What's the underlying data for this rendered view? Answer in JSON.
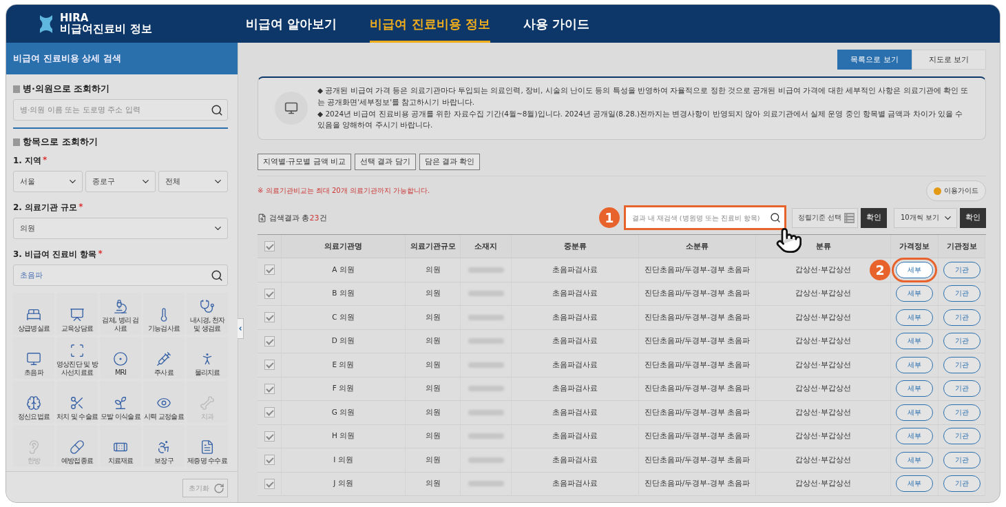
{
  "header": {
    "logo_title": "HIRA",
    "logo_subtitle": "비급여진료비 정보",
    "nav": [
      {
        "label": "비급여 알아보기",
        "selected": false
      },
      {
        "label": "비급여 진료비용 정보",
        "selected": true
      },
      {
        "label": "사용 가이드",
        "selected": false
      }
    ]
  },
  "sidebar": {
    "title": "비급여 진료비용 상세 검색",
    "hospital_search": {
      "heading": "병·의원으로 조회하기",
      "placeholder": "병·의원 이름 또는 도로명 주소 입력"
    },
    "item_search": {
      "heading": "항목으로 조회하기",
      "region": {
        "label": "1. 지역",
        "required": "*",
        "selects": [
          "서울",
          "종로구",
          "전체"
        ]
      },
      "scale": {
        "label": "2. 의료기관 규모",
        "required": "*",
        "value": "의원"
      },
      "item": {
        "label": "3. 비급여 진료비 항목",
        "required": "*",
        "value": "초음파"
      },
      "categories": [
        {
          "label": "상급병실료",
          "disabled": false
        },
        {
          "label": "교육상담료",
          "disabled": false
        },
        {
          "label": "검체, 병리 검사료",
          "disabled": false
        },
        {
          "label": "기능검사료",
          "disabled": false
        },
        {
          "label": "내시경, 천자 및 생검료",
          "disabled": false
        },
        {
          "label": "초음파",
          "disabled": false
        },
        {
          "label": "영상진단 및 방사선치료료",
          "disabled": false
        },
        {
          "label": "MRI",
          "disabled": false
        },
        {
          "label": "주사료",
          "disabled": false
        },
        {
          "label": "물리치료",
          "disabled": false
        },
        {
          "label": "정신요법료",
          "disabled": false
        },
        {
          "label": "처치 및 수술료",
          "disabled": false
        },
        {
          "label": "모발 이식술료",
          "disabled": false
        },
        {
          "label": "시력 교정술료",
          "disabled": false
        },
        {
          "label": "치과",
          "disabled": true
        },
        {
          "label": "한방",
          "disabled": true
        },
        {
          "label": "예방접종료",
          "disabled": false
        },
        {
          "label": "치료재료",
          "disabled": false
        },
        {
          "label": "보장구",
          "disabled": false
        },
        {
          "label": "제증명 수수료",
          "disabled": false
        }
      ]
    },
    "reset_button": "초기화"
  },
  "view_toggle": [
    {
      "label": "목록으로 보기",
      "selected": true
    },
    {
      "label": "지도로 보기",
      "selected": false
    }
  ],
  "notice": [
    "◆ 공개된 비급여 가격 등은 의료기관마다 투입되는 의료인력, 장비, 시술의 난이도 등의 특성을 반영하여 자율적으로 정한 것으로 공개된 비급여 가격에 대한 세부적인 사항은 의료기관에 확인 또는 공개화면'세부정보'를 참고하시기 바랍니다.",
    "◆ 2024년 비급여 진료비용 공개를 위한 자료수집 기간(4월~8월)입니다. 2024년 공개일(8.28.)전까지는 변경사항이 반영되지 않아 의료기관에서 실제 운영 중인 항목별 금액과 차이가 있을 수 있음을 양해하여 주시기 바랍니다."
  ],
  "actions": [
    "지역별·규모별 금액 비교",
    "선택 결과 담기",
    "담은 결과 확인"
  ],
  "compare_note": "※ 의료기관비교는 최대 20개 의료기관까지 가능합니다.",
  "guide_button": "이용가이드",
  "results": {
    "prefix": "검색결과 총",
    "count": "23",
    "suffix": "건"
  },
  "refine_search": {
    "placeholder": "결과 내 재검색 (병원명 또는 진료비 항목)",
    "callout": "1"
  },
  "sort": {
    "label": "정렬기준 선택",
    "confirm": "확인"
  },
  "page_size": {
    "value": "10개씩 보기",
    "confirm": "확인"
  },
  "table": {
    "header_checked": true,
    "columns": [
      "의료기관명",
      "의료기관규모",
      "소재지",
      "중분류",
      "소분류",
      "분류",
      "가격정보",
      "기관정보"
    ],
    "callout": "2",
    "rows": [
      {
        "checked": true,
        "name": "A  의원",
        "scale": "의원",
        "middle": "초음파검사료",
        "small": "진단초음파/두경부-경부 초음파",
        "detail": "갑상선·부갑상선",
        "price": "세부",
        "org": "기관",
        "highlighted": true
      },
      {
        "checked": true,
        "name": "B  의원",
        "scale": "의원",
        "middle": "초음파검사료",
        "small": "진단초음파/두경부-경부 초음파",
        "detail": "갑상선·부갑상선",
        "price": "세부",
        "org": "기관",
        "highlighted": false
      },
      {
        "checked": true,
        "name": "C  의원",
        "scale": "의원",
        "middle": "초음파검사료",
        "small": "진단초음파/두경부-경부 초음파",
        "detail": "갑상선·부갑상선",
        "price": "세부",
        "org": "기관",
        "highlighted": false
      },
      {
        "checked": true,
        "name": "D  의원",
        "scale": "의원",
        "middle": "초음파검사료",
        "small": "진단초음파/두경부-경부 초음파",
        "detail": "갑상선·부갑상선",
        "price": "세부",
        "org": "기관",
        "highlighted": false
      },
      {
        "checked": true,
        "name": "E  의원",
        "scale": "의원",
        "middle": "초음파검사료",
        "small": "진단초음파/두경부-경부 초음파",
        "detail": "갑상선·부갑상선",
        "price": "세부",
        "org": "기관",
        "highlighted": false
      },
      {
        "checked": true,
        "name": "F  의원",
        "scale": "의원",
        "middle": "초음파검사료",
        "small": "진단초음파/두경부-경부 초음파",
        "detail": "갑상선·부갑상선",
        "price": "세부",
        "org": "기관",
        "highlighted": false
      },
      {
        "checked": true,
        "name": "G  의원",
        "scale": "의원",
        "middle": "초음파검사료",
        "small": "진단초음파/두경부-경부 초음파",
        "detail": "갑상선·부갑상선",
        "price": "세부",
        "org": "기관",
        "highlighted": false
      },
      {
        "checked": true,
        "name": "H  의원",
        "scale": "의원",
        "middle": "초음파검사료",
        "small": "진단초음파/두경부-경부 초음파",
        "detail": "갑상선·부갑상선",
        "price": "세부",
        "org": "기관",
        "highlighted": false
      },
      {
        "checked": true,
        "name": "I  의원",
        "scale": "의원",
        "middle": "초음파검사료",
        "small": "진단초음파/두경부-경부 초음파",
        "detail": "갑상선·부갑상선",
        "price": "세부",
        "org": "기관",
        "highlighted": false
      },
      {
        "checked": true,
        "name": "J  의원",
        "scale": "의원",
        "middle": "초음파검사료",
        "small": "진단초음파/두경부-경부 초음파",
        "detail": "갑상선·부갑상선",
        "price": "세부",
        "org": "기관",
        "highlighted": false
      }
    ]
  }
}
